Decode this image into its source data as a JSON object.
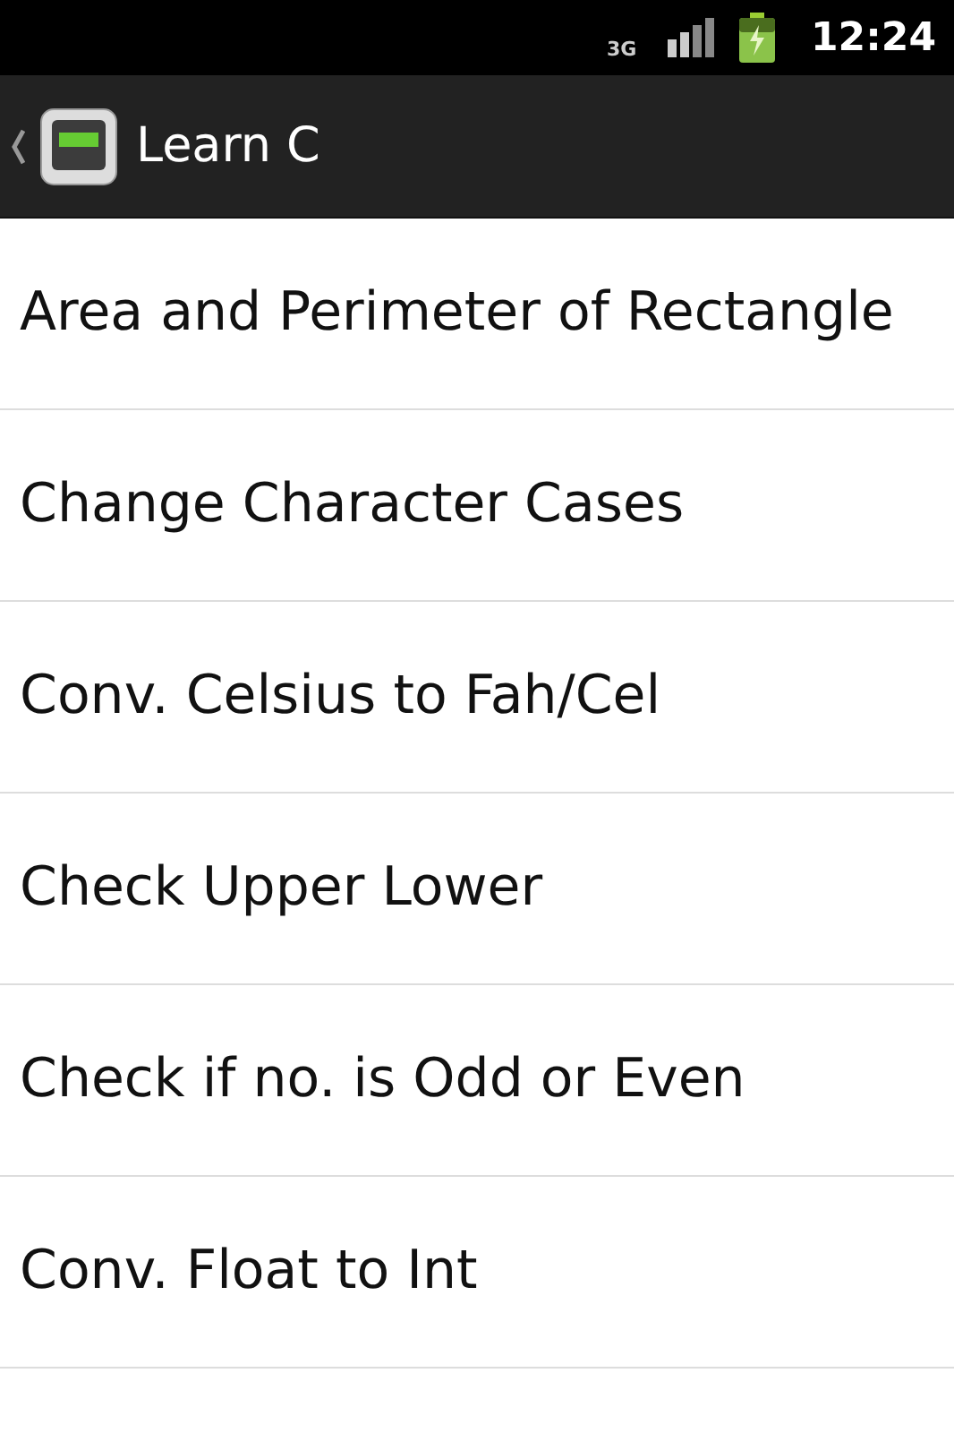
{
  "status_bar": {
    "network": "3G",
    "time": "12:24"
  },
  "action_bar": {
    "title": "Learn C"
  },
  "items": [
    {
      "label": "Area and Perimeter of Rectangle"
    },
    {
      "label": "Change Character Cases"
    },
    {
      "label": "Conv. Celsius to Fah/Cel"
    },
    {
      "label": "Check Upper Lower"
    },
    {
      "label": "Check if no. is Odd or Even"
    },
    {
      "label": "Conv. Float to Int"
    }
  ]
}
